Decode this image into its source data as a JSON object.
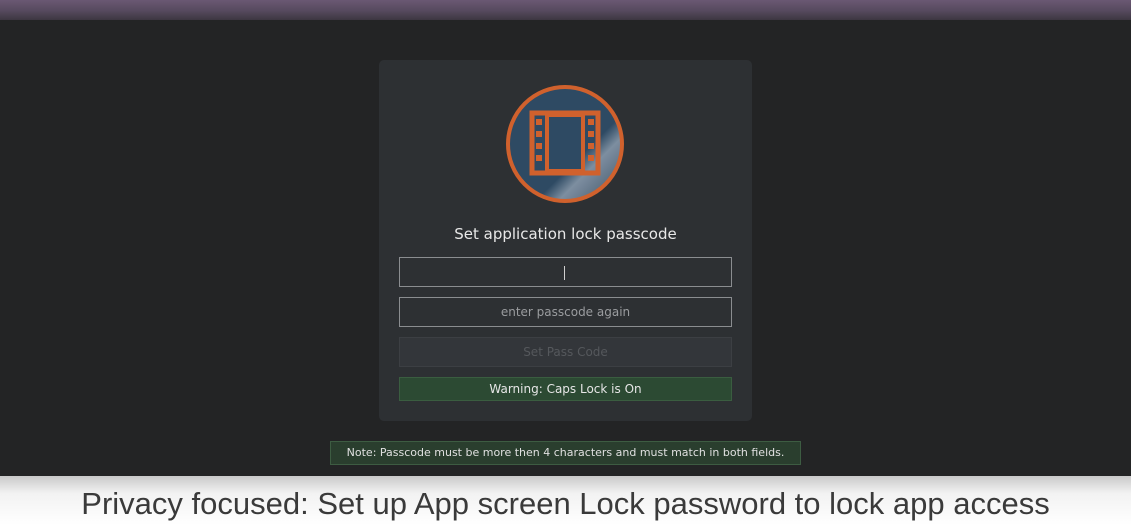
{
  "dialog": {
    "title": "Set application lock passcode",
    "passcode_field": {
      "value": "",
      "placeholder": ""
    },
    "confirm_field": {
      "value": "",
      "placeholder": "enter passcode again"
    },
    "set_button_label": "Set Pass Code",
    "warning_text": "Warning: Caps Lock is On",
    "logo_icon": "film-strip-icon"
  },
  "note_text": "Note: Passcode must be more then 4 characters and must match in both fields.",
  "caption": "Privacy focused: Set up App screen Lock password to lock app access",
  "colors": {
    "accent": "#d0612d",
    "logo_bg": "#2f4a63",
    "warning_bg": "#2c4a33",
    "note_bg": "#2a3e2e"
  }
}
